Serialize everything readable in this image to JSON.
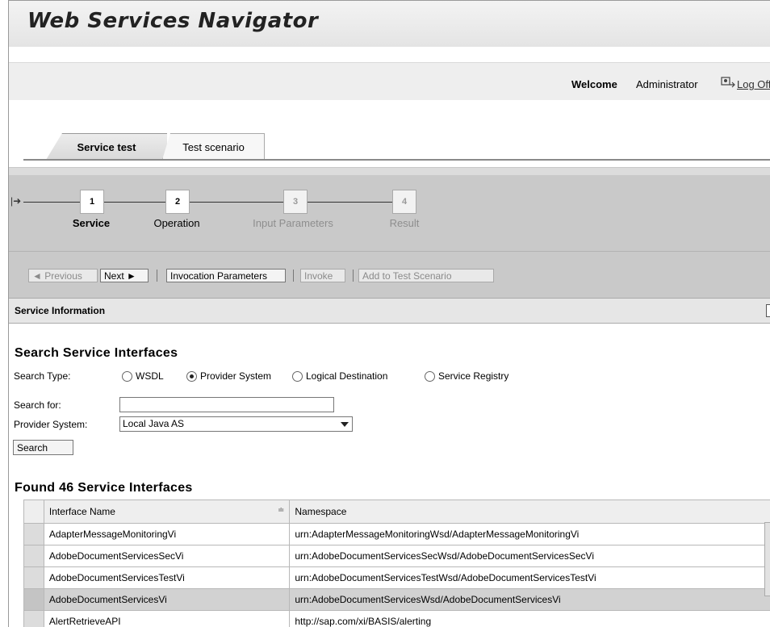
{
  "app": {
    "title": "Web Services Navigator"
  },
  "user_bar": {
    "welcome": "Welcome",
    "username": "Administrator",
    "logoff": "Log Off"
  },
  "tabs": [
    {
      "label": "Service test",
      "active": true
    },
    {
      "label": "Test scenario",
      "active": false
    }
  ],
  "roadmap": {
    "steps": [
      {
        "number": "1",
        "label": "Service",
        "state": "active"
      },
      {
        "number": "2",
        "label": "Operation",
        "state": "enabled"
      },
      {
        "number": "3",
        "label": "Input Parameters",
        "state": "disabled"
      },
      {
        "number": "4",
        "label": "Result",
        "state": "disabled"
      }
    ]
  },
  "toolbar": {
    "previous": "◄ Previous",
    "next": "Next ►",
    "invocation_parameters": "Invocation Parameters",
    "invoke": "Invoke",
    "add_to_test_scenario": "Add to Test Scenario"
  },
  "section": {
    "title": "Service Information"
  },
  "search": {
    "heading": "Search Service Interfaces",
    "type_label": "Search Type:",
    "types": [
      {
        "label": "WSDL",
        "checked": false
      },
      {
        "label": "Provider System",
        "checked": true
      },
      {
        "label": "Logical Destination",
        "checked": false
      },
      {
        "label": "Service Registry",
        "checked": false
      }
    ],
    "search_for_label": "Search for:",
    "search_for_value": "",
    "provider_label": "Provider System:",
    "provider_value": "Local Java AS",
    "button": "Search"
  },
  "results": {
    "heading": "Found 46 Service Interfaces",
    "columns": [
      "Interface Name",
      "Namespace"
    ],
    "rows": [
      {
        "name": "AdapterMessageMonitoringVi",
        "namespace": "urn:AdapterMessageMonitoringWsd/AdapterMessageMonitoringVi"
      },
      {
        "name": "AdobeDocumentServicesSecVi",
        "namespace": "urn:AdobeDocumentServicesSecWsd/AdobeDocumentServicesSecVi"
      },
      {
        "name": "AdobeDocumentServicesTestVi",
        "namespace": "urn:AdobeDocumentServicesTestWsd/AdobeDocumentServicesTestVi"
      },
      {
        "name": "AdobeDocumentServicesVi",
        "namespace": "urn:AdobeDocumentServicesWsd/AdobeDocumentServicesVi",
        "selected": true
      },
      {
        "name": "AlertRetrieveAPI",
        "namespace": "http://sap.com/xi/BASIS/alerting"
      }
    ]
  }
}
